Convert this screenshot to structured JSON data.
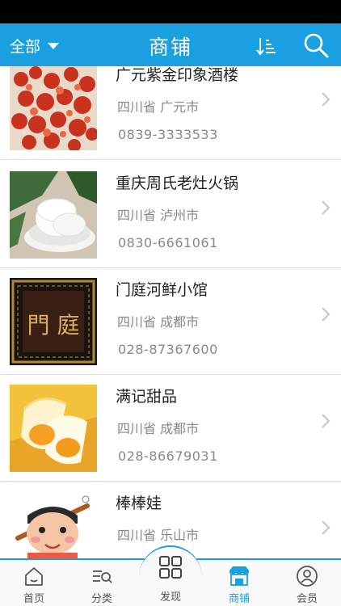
{
  "header": {
    "filter_label": "全部",
    "title": "商铺",
    "sort_icon": "sort-icon",
    "search_icon": "search-icon",
    "accent_color": "#1a9fe0"
  },
  "shops": [
    {
      "name": "广元紫金印象酒楼",
      "region": "四川省 广元市",
      "phone": "0839-3333533"
    },
    {
      "name": "重庆周氏老灶火锅",
      "region": "四川省 泸州市",
      "phone": "0830-6661061"
    },
    {
      "name": "门庭河鲜小馆",
      "region": "四川省 成都市",
      "phone": "028-87367600",
      "thumb_text": "門 庭"
    },
    {
      "name": "满记甜品",
      "region": "四川省 成都市",
      "phone": "028-86679031"
    },
    {
      "name": "棒棒娃",
      "region": "四川省 乐山市",
      "phone": ""
    }
  ],
  "tabbar": {
    "items": [
      {
        "label": "首页",
        "icon": "home-icon"
      },
      {
        "label": "分类",
        "icon": "category-icon"
      },
      {
        "label": "发现",
        "icon": "discover-icon"
      },
      {
        "label": "商铺",
        "icon": "shop-icon",
        "active": true
      },
      {
        "label": "会员",
        "icon": "member-icon"
      }
    ]
  }
}
